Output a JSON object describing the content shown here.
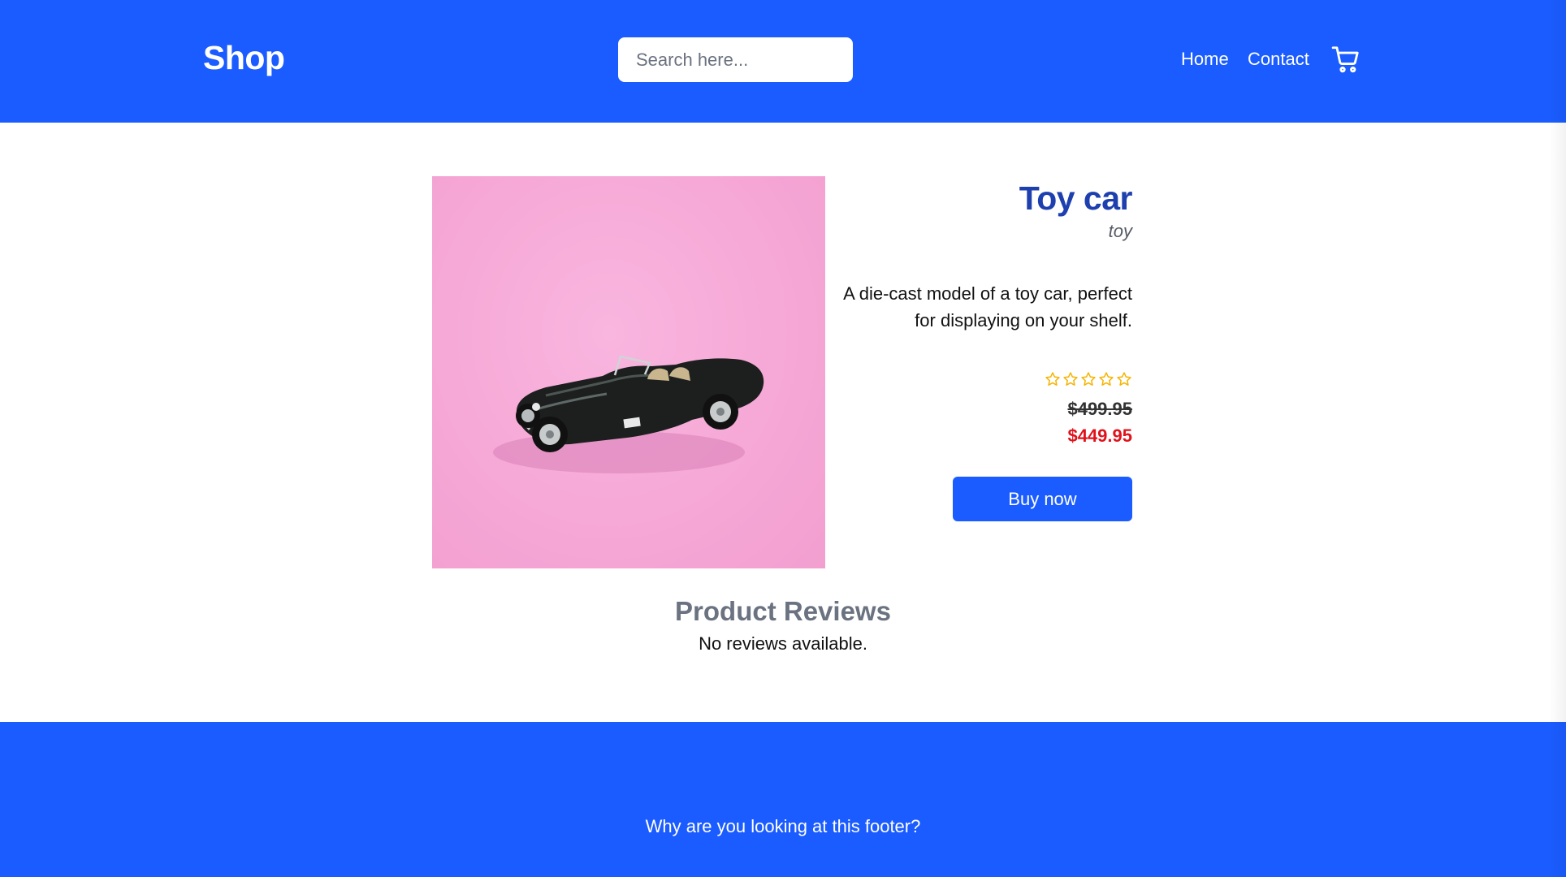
{
  "header": {
    "brand": "Shop",
    "search": {
      "placeholder": "Search here...",
      "value": ""
    },
    "nav": {
      "home": "Home",
      "contact": "Contact"
    },
    "cart_icon": "shopping-cart-icon"
  },
  "product": {
    "name": "Toy car",
    "category": "toy",
    "description": "A die-cast model of a toy car, perfect for displaying on your shelf.",
    "rating": {
      "value": 0,
      "max": 5
    },
    "original_price": "$499.95",
    "sale_price": "$449.95",
    "buy_label": "Buy now"
  },
  "reviews": {
    "title": "Product Reviews",
    "empty_message": "No reviews available."
  },
  "footer": {
    "text": "Why are you looking at this footer?"
  },
  "colors": {
    "brand_blue": "#1a5cff",
    "title_blue": "#1e40af",
    "sale_red": "#e0121b",
    "star_gold": "#f5b400",
    "image_pink": "#f6a8d6"
  }
}
